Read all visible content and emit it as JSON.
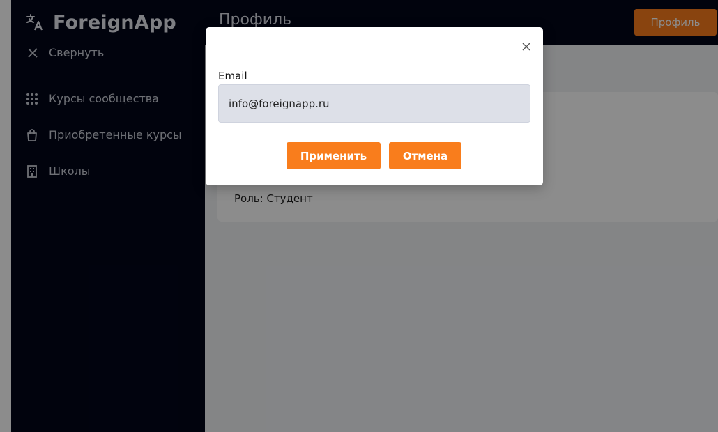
{
  "app": {
    "name": "ForeignApp"
  },
  "sidebar": {
    "collapse_label": "Свернуть",
    "items": [
      {
        "label": "Курсы сообщества",
        "icon": "grid-dots-icon"
      },
      {
        "label": "Приобретенные курсы",
        "icon": "shopping-bag-icon"
      },
      {
        "label": "Школы",
        "icon": "building-icon"
      }
    ]
  },
  "header": {
    "title": "Профиль",
    "profile_button": "Профиль"
  },
  "profile": {
    "role": "Роль: Студент"
  },
  "modal": {
    "email_label": "Email",
    "email_value": "info@foreignapp.ru",
    "apply_button": "Применить",
    "cancel_button": "Отмена"
  },
  "colors": {
    "sidebar_bg": "#020619",
    "accent": "#f97d1c",
    "overlay": "rgba(0,0,0,0.45)"
  }
}
